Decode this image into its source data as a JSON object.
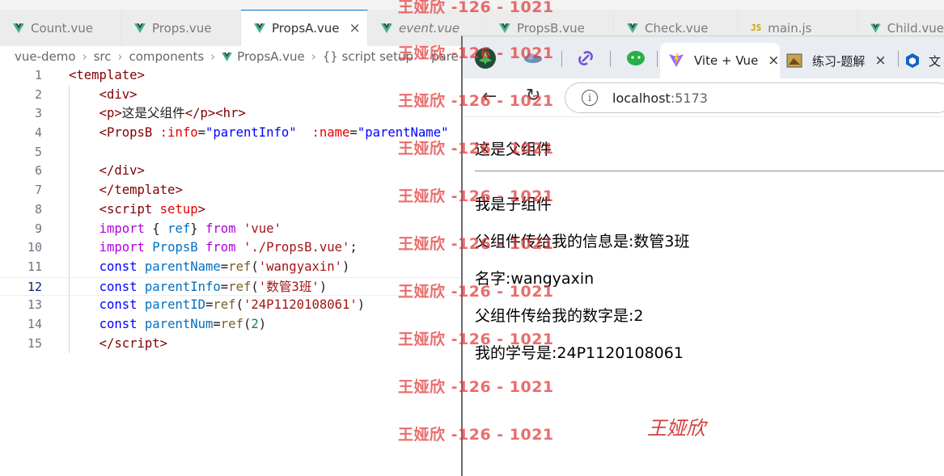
{
  "editor": {
    "tabs": [
      {
        "label": "Count.vue",
        "icon": "vue-icon"
      },
      {
        "label": "Props.vue",
        "icon": "vue-icon"
      },
      {
        "label": "PropsA.vue",
        "icon": "vue-icon",
        "active": true
      },
      {
        "label": "event.vue",
        "icon": "vue-icon"
      },
      {
        "label": "PropsB.vue",
        "icon": "vue-icon"
      },
      {
        "label": "Check.vue",
        "icon": "vue-icon"
      },
      {
        "label": "main.js",
        "icon": "js-icon"
      },
      {
        "label": "Child.vue",
        "icon": "vue-icon"
      }
    ],
    "js_badge": "JS",
    "close_glyph": "×",
    "breadcrumb": [
      "vue-demo",
      "src",
      "components",
      "PropsA.vue",
      "{} script setup",
      "pare"
    ],
    "line_numbers": [
      "1",
      "2",
      "3",
      "4",
      "5",
      "6",
      "7",
      "8",
      "9",
      "10",
      "11",
      "12",
      "13",
      "14",
      "15"
    ],
    "current_line": "12"
  },
  "browser": {
    "tab_label": "Vite + Vue",
    "tab2_label": "练习-题解",
    "tab3_label": "文",
    "url_host": "localhost",
    "url_port": ":5173",
    "info_glyph": "i",
    "back_glyph": "←",
    "reload_glyph": "↻",
    "page_lines": [
      "这是父组件",
      "我是子组件",
      "父组件传给我的信息是:数管3班",
      "名字:wangyaxin",
      "父组件传给我的数字是:2",
      "我的学号是:24P1120108061"
    ]
  },
  "signature": "王娅欣",
  "watermark": "王娅欣 -126 - 1021",
  "colors": {
    "vue_green": "#41b883",
    "vue_dark": "#34495e",
    "watermark_red": "#e23434",
    "tag": "#800000",
    "attr": "#e50000",
    "keyword": "#0000ff"
  }
}
